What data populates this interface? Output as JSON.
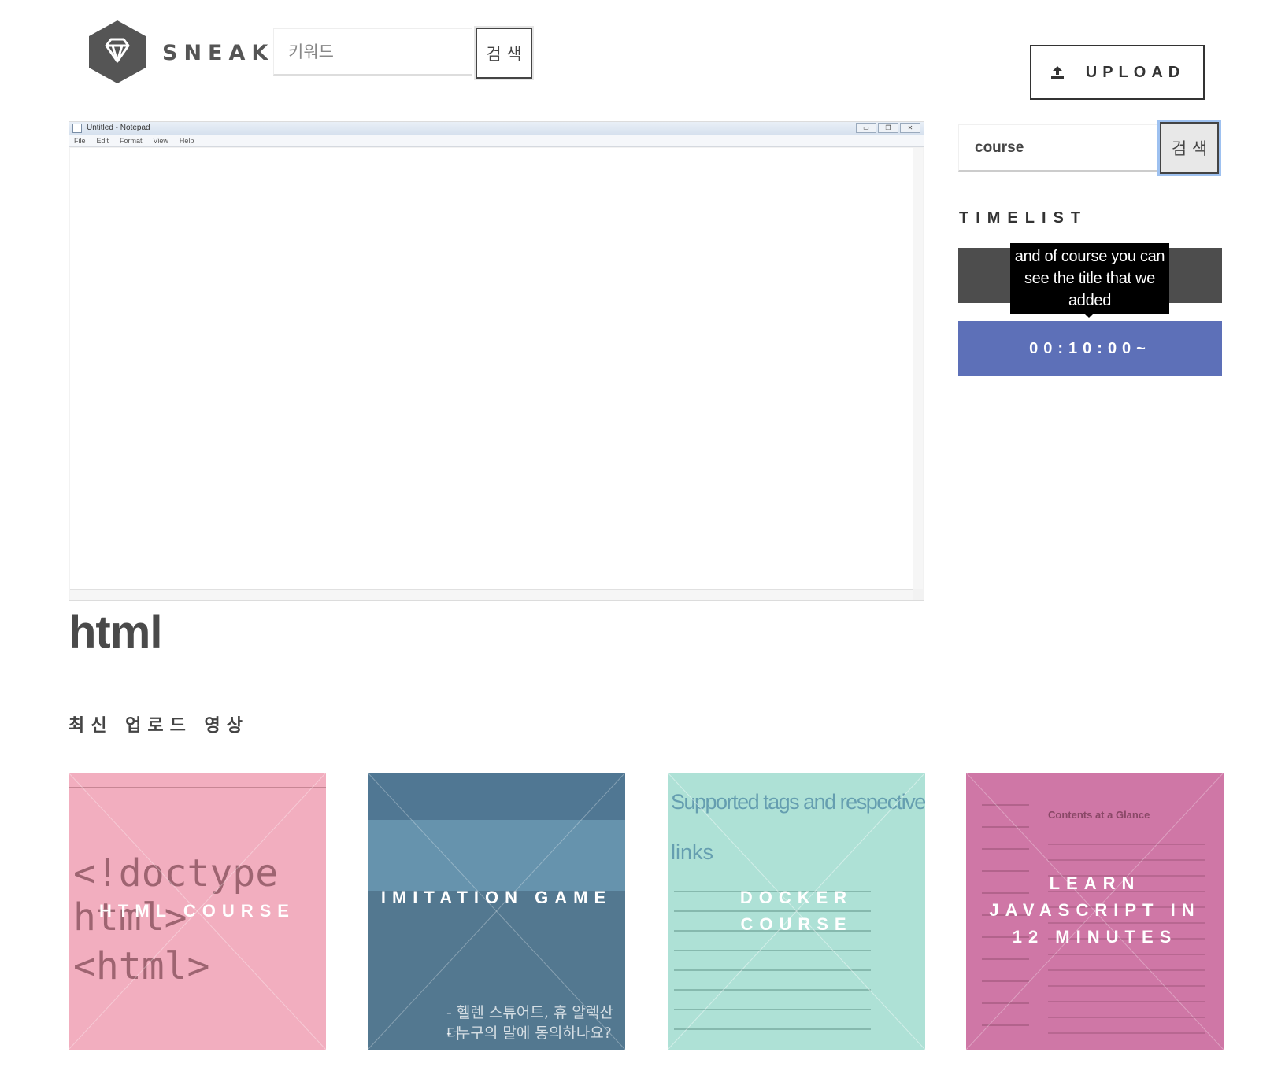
{
  "header": {
    "brand": "SNEAK:",
    "keyword_placeholder": "키워드",
    "search_label": "검 색",
    "upload_label": "UPLOAD"
  },
  "video": {
    "window_title": "Untitled - Notepad",
    "menu": [
      "File",
      "Edit",
      "Format",
      "View",
      "Help"
    ],
    "title": "html"
  },
  "sidebar": {
    "search_value": "course",
    "search_label": "검 색",
    "timelist_label": "TIMELIST",
    "tooltip": "and of course you can see the title that we added",
    "time_item": "00:10:00~"
  },
  "recent": {
    "label": "최신 업로드 영상",
    "cards": [
      {
        "title": "HTML COURSE",
        "color": "#f2aebf",
        "thumb_lines": [
          "<!doctype html>",
          "<html>"
        ]
      },
      {
        "title": "IMITATION GAME",
        "color": "#6693ad",
        "thumb_lines": [
          "- 헬렌 스튜어트, 휴 알렉산더",
          "- 누구의 말에 동의하나요?"
        ]
      },
      {
        "title": "DOCKER COURSE",
        "color": "#aee1d6",
        "thumb_lines": [
          "Supported tags and respective Dockerfile",
          "links"
        ]
      },
      {
        "title": "LEARN JAVASCRIPT IN 12 MINUTES",
        "color": "#cf77a6",
        "thumb_lines": [
          "Contents at a Glance"
        ]
      }
    ]
  },
  "colors": {
    "logo": "#555555",
    "timelist_dark": "#4d4d4d",
    "timelist_blue": "#5d70b8"
  }
}
